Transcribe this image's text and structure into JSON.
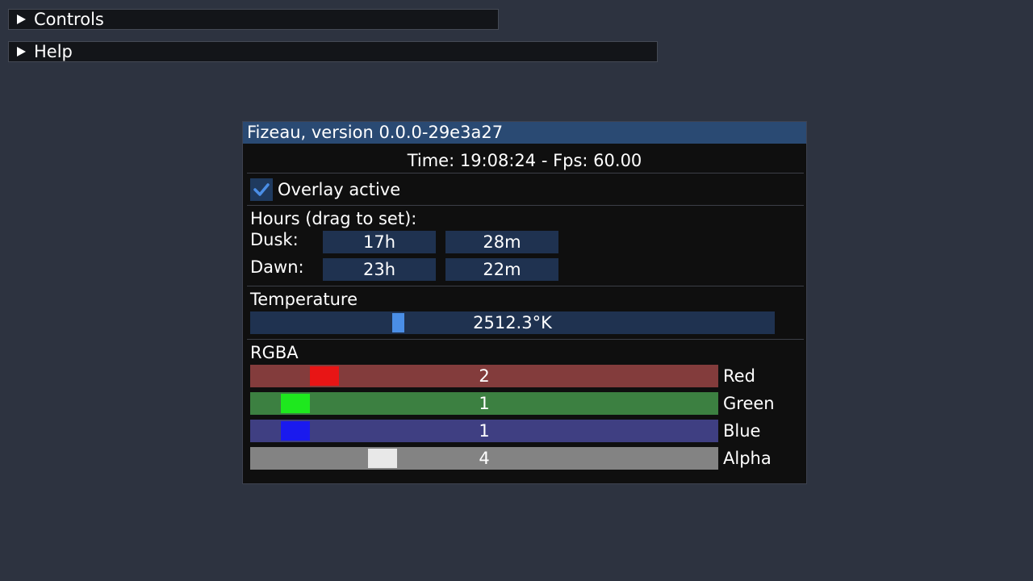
{
  "controls_header": {
    "label": "Controls"
  },
  "help_header": {
    "label": "Help"
  },
  "window": {
    "title": "Fizeau, version 0.0.0-29e3a27",
    "time_line": "Time: 19:08:24 - Fps: 60.00",
    "overlay": {
      "label": "Overlay active",
      "checked": true
    },
    "hours": {
      "heading": "Hours (drag to set):",
      "dusk": {
        "label": "Dusk:",
        "hours": "17h",
        "minutes": "28m"
      },
      "dawn": {
        "label": "Dawn:",
        "hours": "23h",
        "minutes": "22m"
      }
    },
    "temperature": {
      "heading": "Temperature",
      "value": "2512.3°K"
    },
    "rgba": {
      "heading": "RGBA",
      "red": {
        "label": "Red",
        "value": "2"
      },
      "green": {
        "label": "Green",
        "value": "1"
      },
      "blue": {
        "label": "Blue",
        "value": "1"
      },
      "alpha": {
        "label": "Alpha",
        "value": "4"
      }
    }
  },
  "colors": {
    "background": "#2d3340",
    "title_bar": "#2a4a73",
    "accent": "#4a8ee6"
  }
}
